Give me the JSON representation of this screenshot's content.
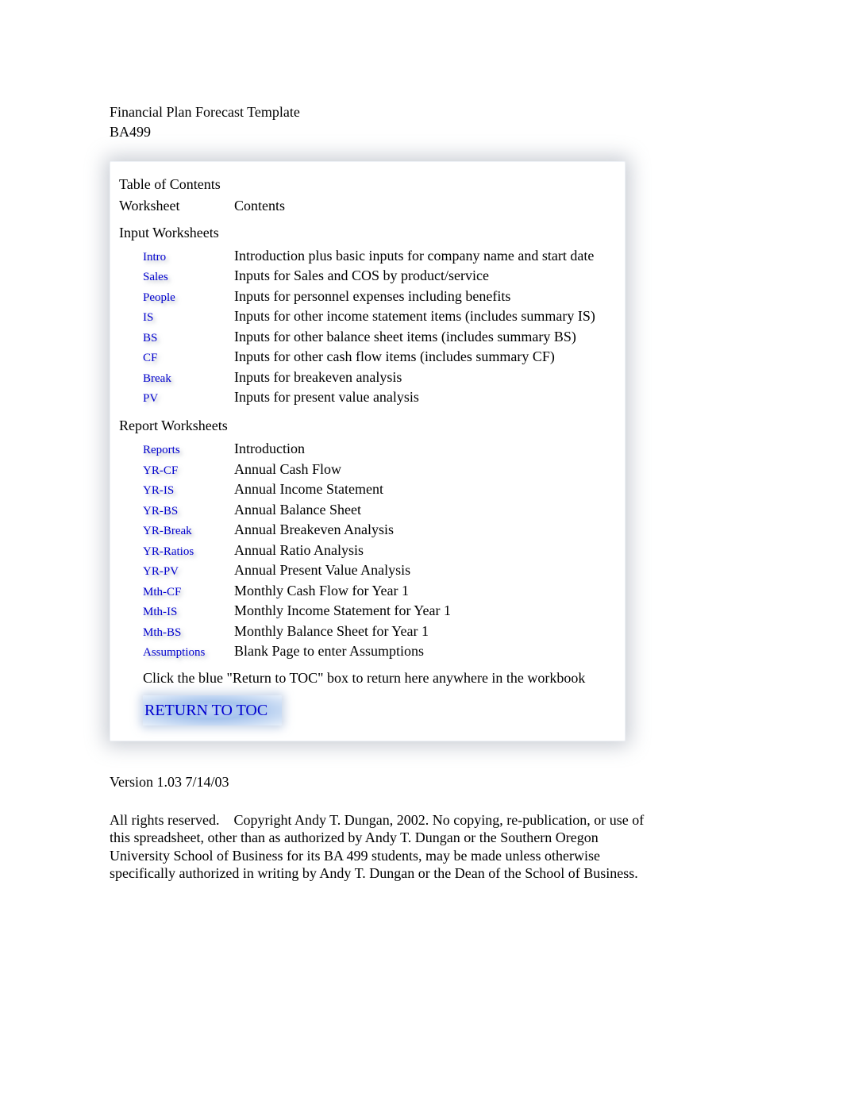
{
  "header": {
    "title": "Financial Plan Forecast Template",
    "subtitle": "BA499"
  },
  "toc": {
    "title": "Table of Contents",
    "col_worksheet": "Worksheet",
    "col_contents": "Contents",
    "input_section": {
      "title": "Input Worksheets",
      "rows": [
        {
          "label": "Intro",
          "desc": "Introduction plus basic inputs for company name and start date"
        },
        {
          "label": "Sales",
          "desc": "Inputs for Sales and COS by product/service"
        },
        {
          "label": "People",
          "desc": "Inputs for personnel expenses including benefits"
        },
        {
          "label": "IS",
          "desc": "Inputs for other income statement items (includes summary IS)"
        },
        {
          "label": "BS",
          "desc": "Inputs for other balance sheet items (includes summary BS)"
        },
        {
          "label": "CF",
          "desc": "Inputs for other cash flow items (includes summary CF)"
        },
        {
          "label": "Break",
          "desc": "Inputs for breakeven analysis"
        },
        {
          "label": "PV",
          "desc": "Inputs for present value analysis"
        }
      ]
    },
    "report_section": {
      "title": "Report Worksheets",
      "rows": [
        {
          "label": "Reports",
          "desc": "Introduction"
        },
        {
          "label": "YR-CF",
          "desc": "Annual Cash Flow"
        },
        {
          "label": "YR-IS",
          "desc": "Annual Income Statement"
        },
        {
          "label": "YR-BS",
          "desc": "Annual Balance Sheet"
        },
        {
          "label": "YR-Break",
          "desc": "Annual Breakeven Analysis"
        },
        {
          "label": "YR-Ratios",
          "desc": "Annual Ratio Analysis"
        },
        {
          "label": "YR-PV",
          "desc": "Annual Present Value Analysis"
        },
        {
          "label": "Mth-CF",
          "desc": "Monthly Cash Flow for Year 1"
        },
        {
          "label": "Mth-IS",
          "desc": "Monthly Income Statement for Year 1"
        },
        {
          "label": "Mth-BS",
          "desc": "Monthly Balance Sheet for Year 1"
        },
        {
          "label": "Assumptions",
          "desc": "Blank Page to enter Assumptions"
        }
      ]
    },
    "instruction": "Click the blue \"Return to TOC\" box to return here anywhere in the workbook",
    "return_button": "RETURN TO TOC"
  },
  "version": "Version 1.03 7/14/03",
  "copyright": "All rights reserved.    Copyright Andy T. Dungan, 2002. No copying, re-publication, or use of this spreadsheet, other than as authorized by Andy T. Dungan or the Southern Oregon University School of Business for its BA 499 students, may be made unless otherwise specifically authorized in writing by Andy T. Dungan or the Dean of the School of Business."
}
